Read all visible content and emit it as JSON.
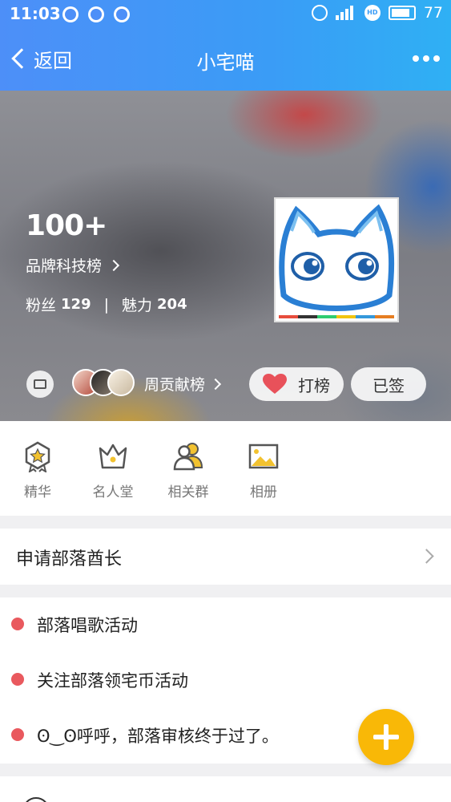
{
  "status_bar": {
    "time": "11:03",
    "network": "4G",
    "hd": "HD",
    "battery": "77"
  },
  "nav": {
    "back_label": "返回",
    "title": "小宅喵"
  },
  "hero": {
    "rank_value": "100+",
    "rank_list_label": "品牌科技榜",
    "fans_label": "粉丝",
    "fans_count": "129",
    "separator": "|",
    "charm_label": "魅力",
    "charm_count": "204",
    "weekly_label": "周贡献榜",
    "bang_button_label": "打榜",
    "signed_button_label": "已签",
    "heart_color": "#e8515a"
  },
  "features": [
    {
      "label": "精华",
      "icon": "star-badge-icon"
    },
    {
      "label": "名人堂",
      "icon": "crown-icon"
    },
    {
      "label": "相关群",
      "icon": "group-icon"
    },
    {
      "label": "相册",
      "icon": "picture-icon"
    }
  ],
  "apply": {
    "label": "申请部落酋长"
  },
  "notices": [
    {
      "text": "部落唱歌活动"
    },
    {
      "text": "关注部落领宅币活动"
    },
    {
      "text": "ʘ‿ʘ呼呼，部落审核终于过了。"
    }
  ],
  "fab": {
    "icon": "plus-icon",
    "color": "#f9b807"
  }
}
